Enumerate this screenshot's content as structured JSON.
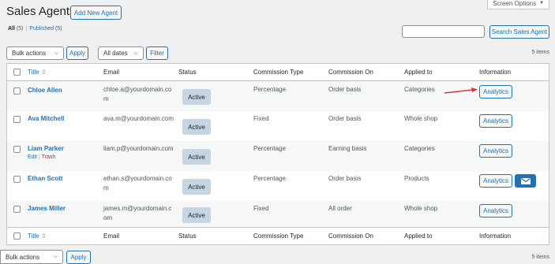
{
  "header": {
    "title": "Sales Agents",
    "add_new_label": "Add New Agent",
    "screen_options_label": "Screen Options"
  },
  "filters": {
    "all_label": "All",
    "all_count": "(5)",
    "separator": "|",
    "published_label": "Published",
    "published_count": "(5)"
  },
  "search": {
    "value": "",
    "button_label": "Search Sales Agent"
  },
  "toolbar_top": {
    "bulk_actions": "Bulk actions",
    "apply_label": "Apply",
    "dates": "All dates",
    "filter_label": "Filter",
    "items_count": "5 items"
  },
  "toolbar_bottom": {
    "bulk_actions": "Bulk actions",
    "apply_label": "Apply",
    "items_count": "5 items"
  },
  "columns": {
    "title": "Title",
    "email": "Email",
    "status": "Status",
    "commission_type": "Commission Type",
    "commission_on": "Commission On",
    "applied_to": "Applied to",
    "information": "Information"
  },
  "rows": [
    {
      "name": "Chloe Allen",
      "email_line1": "chloe.a@yourdomain.co",
      "email_line2": "m",
      "status": "Active",
      "commission_type": "Percentage",
      "commission_on": "Order basis",
      "applied_to": "Categories",
      "info_label": "Analytics"
    },
    {
      "name": "Ava Mitchell",
      "email_line1": "ava.m@yourdomain.com",
      "email_line2": "",
      "status": "Active",
      "commission_type": "Fixed",
      "commission_on": "Order basis",
      "applied_to": "Whole shop",
      "info_label": "Analytics"
    },
    {
      "name": "Liam Parker",
      "email_line1": "liam.p@yourdomain.com",
      "email_line2": "",
      "status": "Active",
      "commission_type": "Percentage",
      "commission_on": "Earning basis",
      "applied_to": "Categories",
      "info_label": "Analytics",
      "edit_label": "Edit",
      "trash_label": "Trash",
      "action_sep": "|"
    },
    {
      "name": "Ethan Scott",
      "email_line1": "ethan.s@yourdomain.co",
      "email_line2": "m",
      "status": "Active",
      "commission_type": "Percentage",
      "commission_on": "Order basis",
      "applied_to": "Products",
      "info_label": "Analytics"
    },
    {
      "name": "James Miller",
      "email_line1": "james.m@yourdomain.c",
      "email_line2": "om",
      "status": "Active",
      "commission_type": "Fixed",
      "commission_on": "All order",
      "applied_to": "Whole shop",
      "info_label": "Analytics"
    }
  ],
  "icons": {
    "sort": "sort-icon",
    "chevron": "chevron-down-icon",
    "mail": "mail-icon",
    "arrow": "arrow-annotation-icon"
  },
  "colors": {
    "link": "#2271b1",
    "status_badge": "#c5d5e2",
    "annotation_arrow": "#d63638",
    "trash": "#b32d2e"
  }
}
